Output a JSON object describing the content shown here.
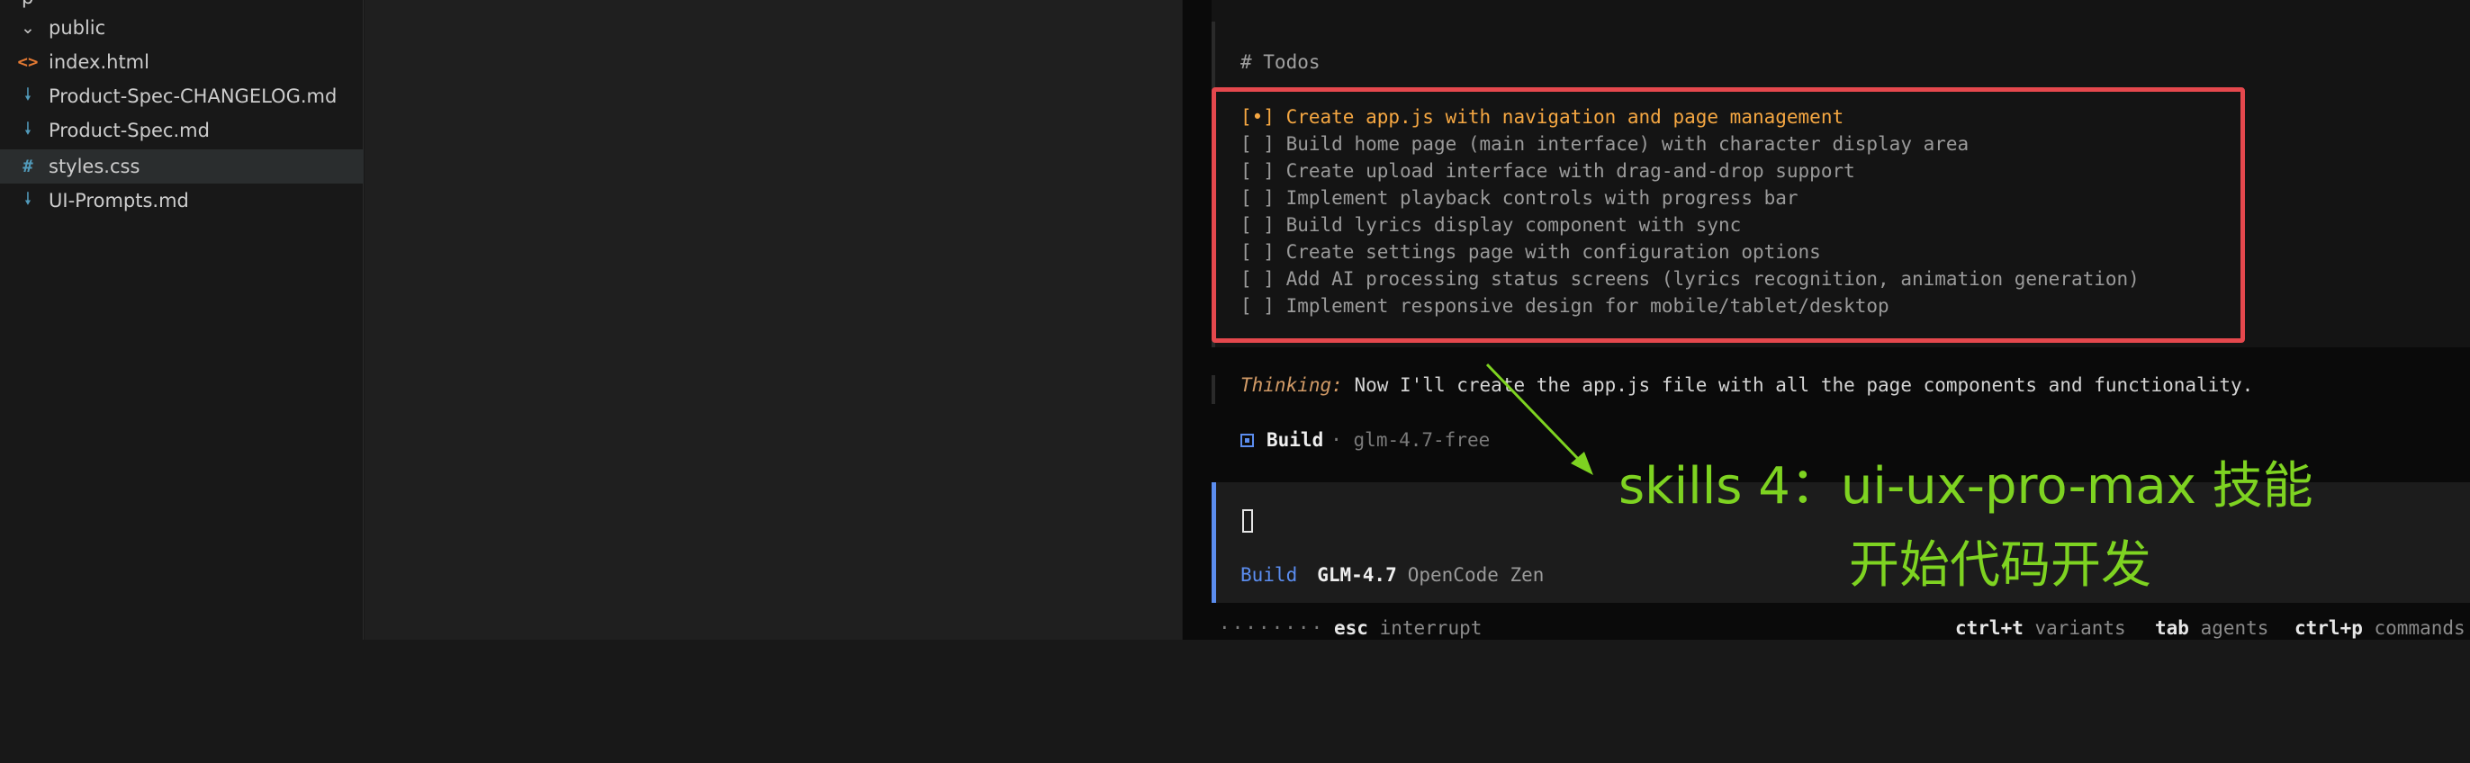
{
  "explorer": {
    "partial_top": "p",
    "items": [
      {
        "label": "public",
        "icon": "chevron-down-icon",
        "kind": "folder"
      },
      {
        "label": "index.html",
        "icon": "html-file-icon",
        "kind": "file"
      },
      {
        "label": "Product-Spec-CHANGELOG.md",
        "icon": "markdown-file-icon",
        "kind": "file"
      },
      {
        "label": "Product-Spec.md",
        "icon": "markdown-file-icon",
        "kind": "file"
      },
      {
        "label": "styles.css",
        "icon": "css-file-icon",
        "kind": "file",
        "selected": true
      },
      {
        "label": "UI-Prompts.md",
        "icon": "markdown-file-icon",
        "kind": "file"
      }
    ]
  },
  "terminal": {
    "todos_header": "# Todos",
    "todos": [
      {
        "mark": "[•]",
        "text": "Create app.js with navigation and page management",
        "active": true
      },
      {
        "mark": "[ ]",
        "text": "Build home page (main interface) with character display area"
      },
      {
        "mark": "[ ]",
        "text": "Create upload interface with drag-and-drop support"
      },
      {
        "mark": "[ ]",
        "text": "Implement playback controls with progress bar"
      },
      {
        "mark": "[ ]",
        "text": "Build lyrics display component with sync"
      },
      {
        "mark": "[ ]",
        "text": "Create settings page with configuration options"
      },
      {
        "mark": "[ ]",
        "text": "Add AI processing status screens (lyrics recognition, animation generation)"
      },
      {
        "mark": "[ ]",
        "text": "Implement responsive design for mobile/tablet/desktop"
      }
    ],
    "thinking_label": "Thinking:",
    "thinking_text": "Now I'll create the app.js file with all the page components and functionality.",
    "build": {
      "label": "Build",
      "sep": "·",
      "model": "glm-4.7-free"
    },
    "prompt": {
      "agent": "Build",
      "model": "GLM-4.7",
      "provider": "OpenCode Zen"
    },
    "status": {
      "dots": "········",
      "left": {
        "key": "esc",
        "desc": "interrupt"
      },
      "right": [
        {
          "key": "ctrl+t",
          "desc": "variants"
        },
        {
          "key": "tab",
          "desc": "agents"
        },
        {
          "key": "ctrl+p",
          "desc": "commands"
        }
      ]
    }
  },
  "annotation": {
    "line1": "skills 4：ui-ux-pro-max 技能",
    "line2": "开始代码开发",
    "box_color": "#e5484d",
    "arrow_color": "#7ed321"
  },
  "colors": {
    "accent": "#5b8def",
    "todo_active": "#f5a742",
    "thinking": "#d19a66"
  }
}
